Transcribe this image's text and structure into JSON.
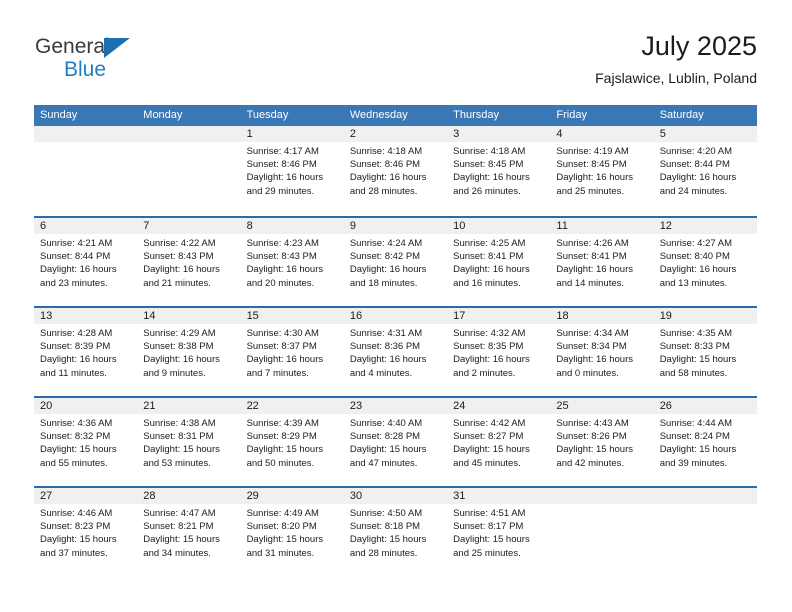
{
  "brand": {
    "name_top": "General",
    "name_bottom": "Blue",
    "logo_icon": "blue-triangle-icon",
    "accent_color": "#1c6fb4"
  },
  "header": {
    "title": "July 2025",
    "subtitle": "Fajslawice, Lublin, Poland"
  },
  "calendar": {
    "header_color": "#3a77b5",
    "row_divider_color": "#2a6bab",
    "day_band_color": "#f0f0f0",
    "weekday_headers": [
      "Sunday",
      "Monday",
      "Tuesday",
      "Wednesday",
      "Thursday",
      "Friday",
      "Saturday"
    ],
    "weeks": [
      [
        {
          "day": "",
          "lines": [
            "",
            "",
            "",
            ""
          ]
        },
        {
          "day": "",
          "lines": [
            "",
            "",
            "",
            ""
          ]
        },
        {
          "day": "1",
          "lines": [
            "Sunrise: 4:17 AM",
            "Sunset: 8:46 PM",
            "Daylight: 16 hours",
            "and 29 minutes."
          ]
        },
        {
          "day": "2",
          "lines": [
            "Sunrise: 4:18 AM",
            "Sunset: 8:46 PM",
            "Daylight: 16 hours",
            "and 28 minutes."
          ]
        },
        {
          "day": "3",
          "lines": [
            "Sunrise: 4:18 AM",
            "Sunset: 8:45 PM",
            "Daylight: 16 hours",
            "and 26 minutes."
          ]
        },
        {
          "day": "4",
          "lines": [
            "Sunrise: 4:19 AM",
            "Sunset: 8:45 PM",
            "Daylight: 16 hours",
            "and 25 minutes."
          ]
        },
        {
          "day": "5",
          "lines": [
            "Sunrise: 4:20 AM",
            "Sunset: 8:44 PM",
            "Daylight: 16 hours",
            "and 24 minutes."
          ]
        }
      ],
      [
        {
          "day": "6",
          "lines": [
            "Sunrise: 4:21 AM",
            "Sunset: 8:44 PM",
            "Daylight: 16 hours",
            "and 23 minutes."
          ]
        },
        {
          "day": "7",
          "lines": [
            "Sunrise: 4:22 AM",
            "Sunset: 8:43 PM",
            "Daylight: 16 hours",
            "and 21 minutes."
          ]
        },
        {
          "day": "8",
          "lines": [
            "Sunrise: 4:23 AM",
            "Sunset: 8:43 PM",
            "Daylight: 16 hours",
            "and 20 minutes."
          ]
        },
        {
          "day": "9",
          "lines": [
            "Sunrise: 4:24 AM",
            "Sunset: 8:42 PM",
            "Daylight: 16 hours",
            "and 18 minutes."
          ]
        },
        {
          "day": "10",
          "lines": [
            "Sunrise: 4:25 AM",
            "Sunset: 8:41 PM",
            "Daylight: 16 hours",
            "and 16 minutes."
          ]
        },
        {
          "day": "11",
          "lines": [
            "Sunrise: 4:26 AM",
            "Sunset: 8:41 PM",
            "Daylight: 16 hours",
            "and 14 minutes."
          ]
        },
        {
          "day": "12",
          "lines": [
            "Sunrise: 4:27 AM",
            "Sunset: 8:40 PM",
            "Daylight: 16 hours",
            "and 13 minutes."
          ]
        }
      ],
      [
        {
          "day": "13",
          "lines": [
            "Sunrise: 4:28 AM",
            "Sunset: 8:39 PM",
            "Daylight: 16 hours",
            "and 11 minutes."
          ]
        },
        {
          "day": "14",
          "lines": [
            "Sunrise: 4:29 AM",
            "Sunset: 8:38 PM",
            "Daylight: 16 hours",
            "and 9 minutes."
          ]
        },
        {
          "day": "15",
          "lines": [
            "Sunrise: 4:30 AM",
            "Sunset: 8:37 PM",
            "Daylight: 16 hours",
            "and 7 minutes."
          ]
        },
        {
          "day": "16",
          "lines": [
            "Sunrise: 4:31 AM",
            "Sunset: 8:36 PM",
            "Daylight: 16 hours",
            "and 4 minutes."
          ]
        },
        {
          "day": "17",
          "lines": [
            "Sunrise: 4:32 AM",
            "Sunset: 8:35 PM",
            "Daylight: 16 hours",
            "and 2 minutes."
          ]
        },
        {
          "day": "18",
          "lines": [
            "Sunrise: 4:34 AM",
            "Sunset: 8:34 PM",
            "Daylight: 16 hours",
            "and 0 minutes."
          ]
        },
        {
          "day": "19",
          "lines": [
            "Sunrise: 4:35 AM",
            "Sunset: 8:33 PM",
            "Daylight: 15 hours",
            "and 58 minutes."
          ]
        }
      ],
      [
        {
          "day": "20",
          "lines": [
            "Sunrise: 4:36 AM",
            "Sunset: 8:32 PM",
            "Daylight: 15 hours",
            "and 55 minutes."
          ]
        },
        {
          "day": "21",
          "lines": [
            "Sunrise: 4:38 AM",
            "Sunset: 8:31 PM",
            "Daylight: 15 hours",
            "and 53 minutes."
          ]
        },
        {
          "day": "22",
          "lines": [
            "Sunrise: 4:39 AM",
            "Sunset: 8:29 PM",
            "Daylight: 15 hours",
            "and 50 minutes."
          ]
        },
        {
          "day": "23",
          "lines": [
            "Sunrise: 4:40 AM",
            "Sunset: 8:28 PM",
            "Daylight: 15 hours",
            "and 47 minutes."
          ]
        },
        {
          "day": "24",
          "lines": [
            "Sunrise: 4:42 AM",
            "Sunset: 8:27 PM",
            "Daylight: 15 hours",
            "and 45 minutes."
          ]
        },
        {
          "day": "25",
          "lines": [
            "Sunrise: 4:43 AM",
            "Sunset: 8:26 PM",
            "Daylight: 15 hours",
            "and 42 minutes."
          ]
        },
        {
          "day": "26",
          "lines": [
            "Sunrise: 4:44 AM",
            "Sunset: 8:24 PM",
            "Daylight: 15 hours",
            "and 39 minutes."
          ]
        }
      ],
      [
        {
          "day": "27",
          "lines": [
            "Sunrise: 4:46 AM",
            "Sunset: 8:23 PM",
            "Daylight: 15 hours",
            "and 37 minutes."
          ]
        },
        {
          "day": "28",
          "lines": [
            "Sunrise: 4:47 AM",
            "Sunset: 8:21 PM",
            "Daylight: 15 hours",
            "and 34 minutes."
          ]
        },
        {
          "day": "29",
          "lines": [
            "Sunrise: 4:49 AM",
            "Sunset: 8:20 PM",
            "Daylight: 15 hours",
            "and 31 minutes."
          ]
        },
        {
          "day": "30",
          "lines": [
            "Sunrise: 4:50 AM",
            "Sunset: 8:18 PM",
            "Daylight: 15 hours",
            "and 28 minutes."
          ]
        },
        {
          "day": "31",
          "lines": [
            "Sunrise: 4:51 AM",
            "Sunset: 8:17 PM",
            "Daylight: 15 hours",
            "and 25 minutes."
          ]
        },
        {
          "day": "",
          "lines": [
            "",
            "",
            "",
            ""
          ]
        },
        {
          "day": "",
          "lines": [
            "",
            "",
            "",
            ""
          ]
        }
      ]
    ]
  }
}
